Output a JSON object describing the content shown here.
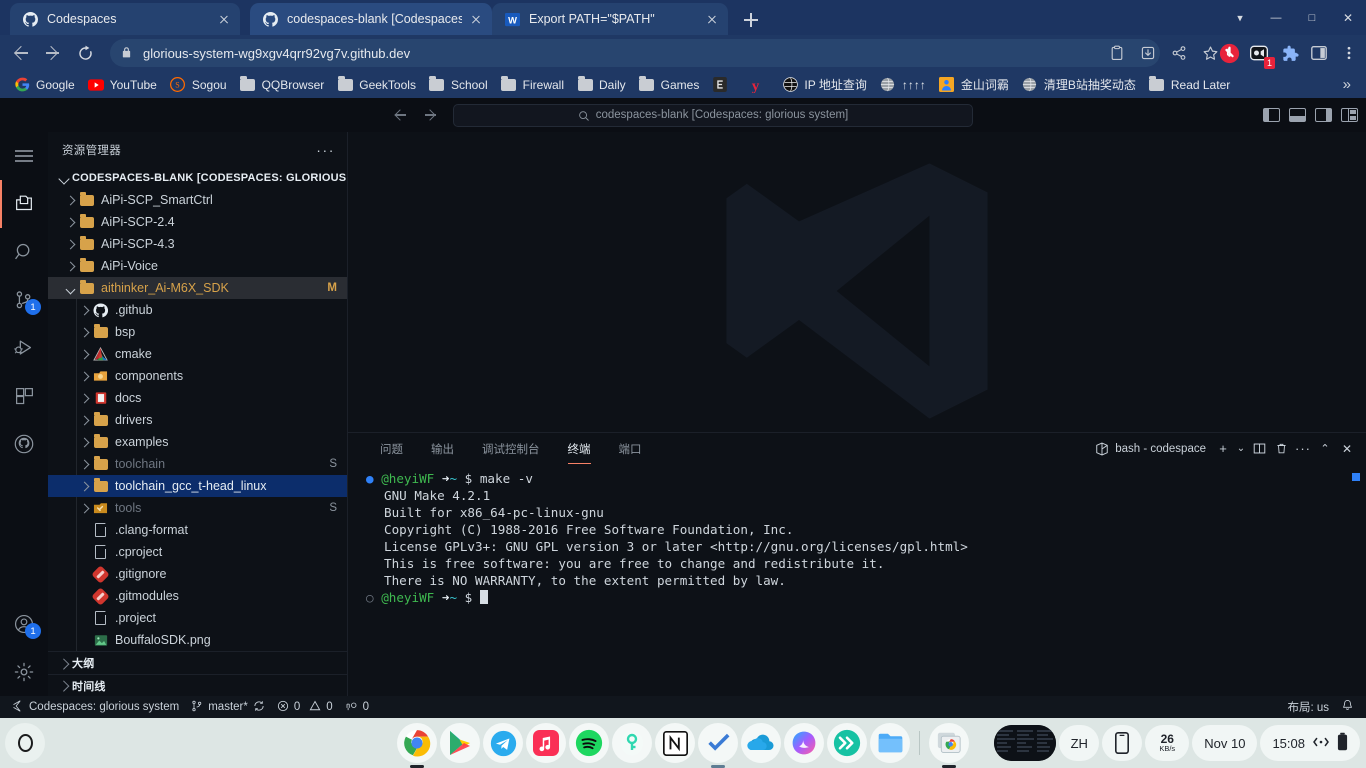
{
  "browser": {
    "tabs": [
      {
        "title": "Codespaces",
        "favicon": "github-icon",
        "active": false
      },
      {
        "title": "codespaces-blank [Codespaces",
        "favicon": "github-icon",
        "active": true
      },
      {
        "title": "Export PATH=\"$PATH\"",
        "favicon": "word-icon",
        "active": false
      }
    ],
    "new_tab_label": "+",
    "window_controls": {
      "list": "⌄",
      "minimize": "—",
      "maximize": "□",
      "close": "✕"
    },
    "omnibox": {
      "url": "glorious-system-wg9xgv4qrr92vg7v.github.dev",
      "lock": "lock-icon"
    },
    "omni_actions": [
      "clipboard-icon",
      "install-icon",
      "share-icon",
      "bookmark-star-icon"
    ],
    "extensions": [
      "adblock-icon",
      "screen-recorder-icon",
      "puzzle-icon",
      "side-panel-icon",
      "chrome-menu-icon"
    ],
    "extension_badge": "1",
    "bookmarks": [
      {
        "label": "Google",
        "icon": "google-icon"
      },
      {
        "label": "YouTube",
        "icon": "youtube-icon"
      },
      {
        "label": "Sogou",
        "icon": "sogou-icon"
      },
      {
        "label": "QQBrowser",
        "icon": "folder-icon"
      },
      {
        "label": "GeekTools",
        "icon": "folder-icon"
      },
      {
        "label": "School",
        "icon": "folder-icon"
      },
      {
        "label": "Firewall",
        "icon": "folder-icon"
      },
      {
        "label": "Daily",
        "icon": "folder-icon"
      },
      {
        "label": "Games",
        "icon": "folder-icon"
      },
      {
        "label": "",
        "icon": "epic-games-icon"
      },
      {
        "label": "",
        "icon": "yandex-icon"
      },
      {
        "label": "IP 地址查询",
        "icon": "globe-dark-icon"
      },
      {
        "label": "↑↑↑↑",
        "icon": "globe-icon"
      },
      {
        "label": "金山词霸",
        "icon": "iciba-icon"
      },
      {
        "label": "清理B站抽奖动态",
        "icon": "globe-icon"
      },
      {
        "label": "Read Later",
        "icon": "folder-icon"
      }
    ],
    "bookmarks_overflow": "»"
  },
  "vscode": {
    "titlebar": {
      "back": "back-arrow-icon",
      "forward": "forward-arrow-icon",
      "command_center_text": "codespaces-blank [Codespaces: glorious system]",
      "layout_buttons": [
        "toggle-primary-sidebar",
        "toggle-panel",
        "toggle-secondary-sidebar",
        "customize-layout"
      ]
    },
    "activitybar": [
      {
        "name": "menu-icon",
        "badge": null,
        "active": false
      },
      {
        "name": "explorer-icon",
        "badge": null,
        "active": true
      },
      {
        "name": "search-icon",
        "badge": null,
        "active": false
      },
      {
        "name": "source-control-icon",
        "badge": "1",
        "active": false
      },
      {
        "name": "run-and-debug-icon",
        "badge": null,
        "active": false
      },
      {
        "name": "extensions-icon",
        "badge": null,
        "active": false
      },
      {
        "name": "github-icon",
        "badge": null,
        "active": false
      },
      {
        "name": "accounts-icon",
        "badge": "1",
        "active": false
      },
      {
        "name": "settings-gear-icon",
        "badge": null,
        "active": false
      }
    ],
    "explorer": {
      "title": "资源管理器",
      "more_actions": "···",
      "root_label": "CODESPACES-BLANK [CODESPACES: GLORIOUS...",
      "tree": [
        {
          "label": "AiPi-SCP_SmartCtrl",
          "icon": "folder-icon",
          "arrow": "right",
          "depth": 1,
          "state": "normal",
          "badge": ""
        },
        {
          "label": "AiPi-SCP-2.4",
          "icon": "folder-icon",
          "arrow": "right",
          "depth": 1,
          "state": "normal",
          "badge": ""
        },
        {
          "label": "AiPi-SCP-4.3",
          "icon": "folder-icon",
          "arrow": "right",
          "depth": 1,
          "state": "normal",
          "badge": ""
        },
        {
          "label": "AiPi-Voice",
          "icon": "folder-icon",
          "arrow": "right",
          "depth": 1,
          "state": "normal",
          "badge": ""
        },
        {
          "label": "aithinker_Ai-M6X_SDK",
          "icon": "folder-icon",
          "arrow": "down",
          "depth": 1,
          "state": "modified",
          "badge": "M"
        },
        {
          "label": ".github",
          "icon": "github-folder-icon",
          "arrow": "right",
          "depth": 2,
          "state": "normal",
          "badge": ""
        },
        {
          "label": "bsp",
          "icon": "folder-icon",
          "arrow": "right",
          "depth": 2,
          "state": "normal",
          "badge": ""
        },
        {
          "label": "cmake",
          "icon": "cmake-icon",
          "arrow": "right",
          "depth": 2,
          "state": "normal",
          "badge": ""
        },
        {
          "label": "components",
          "icon": "components-icon",
          "arrow": "right",
          "depth": 2,
          "state": "normal",
          "badge": ""
        },
        {
          "label": "docs",
          "icon": "docs-icon",
          "arrow": "right",
          "depth": 2,
          "state": "normal",
          "badge": ""
        },
        {
          "label": "drivers",
          "icon": "folder-icon",
          "arrow": "right",
          "depth": 2,
          "state": "normal",
          "badge": ""
        },
        {
          "label": "examples",
          "icon": "folder-icon",
          "arrow": "right",
          "depth": 2,
          "state": "normal",
          "badge": ""
        },
        {
          "label": "toolchain",
          "icon": "folder-icon",
          "arrow": "right",
          "depth": 2,
          "state": "dim",
          "badge": "S"
        },
        {
          "label": "toolchain_gcc_t-head_linux",
          "icon": "folder-icon",
          "arrow": "right",
          "depth": 2,
          "state": "selected",
          "badge": ""
        },
        {
          "label": "tools",
          "icon": "tools-icon",
          "arrow": "right",
          "depth": 2,
          "state": "dim",
          "badge": "S"
        },
        {
          "label": ".clang-format",
          "icon": "file-icon",
          "arrow": "none",
          "depth": 2,
          "state": "normal",
          "badge": ""
        },
        {
          "label": ".cproject",
          "icon": "file-icon",
          "arrow": "none",
          "depth": 2,
          "state": "normal",
          "badge": ""
        },
        {
          "label": ".gitignore",
          "icon": "git-icon",
          "arrow": "none",
          "depth": 2,
          "state": "normal",
          "badge": ""
        },
        {
          "label": ".gitmodules",
          "icon": "git-icon",
          "arrow": "none",
          "depth": 2,
          "state": "normal",
          "badge": ""
        },
        {
          "label": ".project",
          "icon": "file-icon",
          "arrow": "none",
          "depth": 2,
          "state": "normal",
          "badge": ""
        },
        {
          "label": "BouffaloSDK.png",
          "icon": "image-icon",
          "arrow": "none",
          "depth": 2,
          "state": "normal",
          "badge": ""
        }
      ],
      "sections": [
        {
          "label": "大纲"
        },
        {
          "label": "时间线"
        }
      ]
    },
    "panel": {
      "tabs": [
        {
          "label": "问题",
          "active": false
        },
        {
          "label": "输出",
          "active": false
        },
        {
          "label": "调试控制台",
          "active": false
        },
        {
          "label": "终端",
          "active": true
        },
        {
          "label": "端口",
          "active": false
        }
      ],
      "terminal_name": "bash - codespace",
      "actions": [
        "new-terminal-icon",
        "terminal-dropdown-icon",
        "split-terminal-icon",
        "kill-terminal-icon",
        "more-actions-icon",
        "maximize-panel-icon",
        "close-panel-icon"
      ],
      "action_glyphs": [
        "+",
        "⌄",
        "‖",
        "🗑",
        "···",
        "⌃",
        "✕"
      ]
    },
    "terminal": {
      "lines": [
        {
          "type": "prompt",
          "dot": "filled",
          "user": "@heyiWF",
          "arrow": "➜",
          "tilde": "~",
          "dollar": "$",
          "command": "make -v"
        },
        {
          "type": "output",
          "text": "GNU Make 4.2.1"
        },
        {
          "type": "output",
          "text": "Built for x86_64-pc-linux-gnu"
        },
        {
          "type": "output",
          "text": "Copyright (C) 1988-2016 Free Software Foundation, Inc."
        },
        {
          "type": "output",
          "text": "License GPLv3+: GNU GPL version 3 or later <http://gnu.org/licenses/gpl.html>"
        },
        {
          "type": "output",
          "text": "This is free software: you are free to change and redistribute it."
        },
        {
          "type": "output",
          "text": "There is NO WARRANTY, to the extent permitted by law."
        },
        {
          "type": "prompt",
          "dot": "empty",
          "user": "@heyiWF",
          "arrow": "➜",
          "tilde": "~",
          "dollar": "$",
          "command": "",
          "cursor": true
        }
      ]
    },
    "statusbar": {
      "remote": "Codespaces: glorious system",
      "branch": "master*",
      "sync": "sync-icon",
      "errors": "0",
      "warnings": "0",
      "ports": "0",
      "layout": "布局: us",
      "bell": "bell-icon"
    }
  },
  "shelf": {
    "launcher": "launcher-icon",
    "apps": [
      {
        "name": "chrome",
        "running": true
      },
      {
        "name": "play-store",
        "running": false
      },
      {
        "name": "telegram",
        "running": false
      },
      {
        "name": "apple-music",
        "running": false
      },
      {
        "name": "spotify",
        "running": false
      },
      {
        "name": "keyguard",
        "running": false
      },
      {
        "name": "notion",
        "running": false
      },
      {
        "name": "todoist",
        "running": true
      },
      {
        "name": "onedrive",
        "running": false
      },
      {
        "name": "copilot",
        "running": false
      },
      {
        "name": "wps-fast",
        "running": false
      },
      {
        "name": "files",
        "running": false
      },
      {
        "name": "chrome-apps",
        "running": true
      }
    ],
    "tray": {
      "thumbnail": "window-preview",
      "ime": "ZH",
      "phone_hub": "phone-icon",
      "network_speed_value": "26",
      "network_speed_unit": "KB/s",
      "date": "Nov 10",
      "time": "15:08",
      "network": "network-icon",
      "battery": "battery-icon"
    }
  }
}
